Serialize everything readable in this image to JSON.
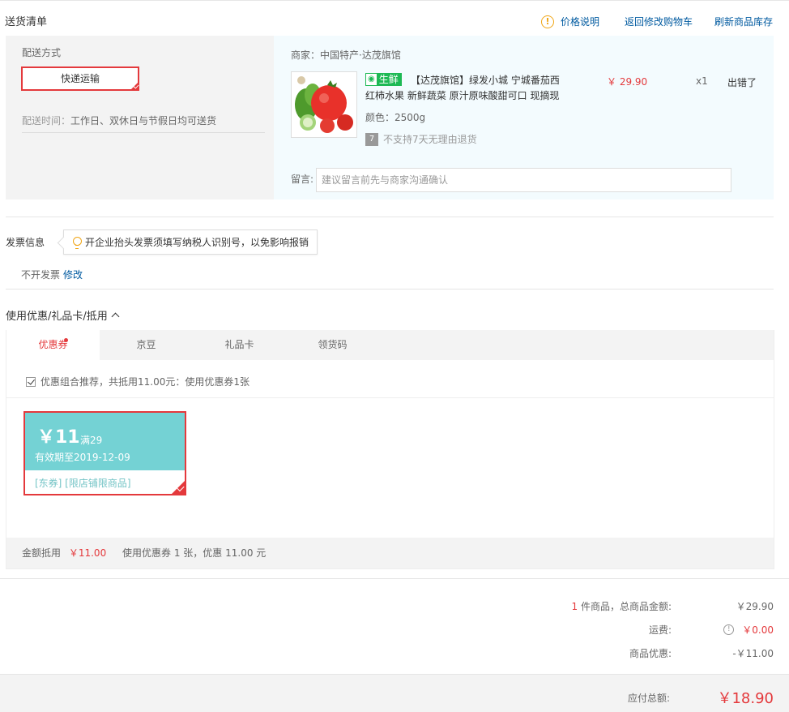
{
  "header": {
    "title": "送货清单",
    "price_info": "价格说明",
    "back_to_cart": "返回修改购物车",
    "refresh_stock": "刷新商品库存"
  },
  "delivery": {
    "method_label": "配送方式",
    "method_value": "快递运输",
    "time_label": "配送时间：",
    "time_value": "工作日、双休日与节假日均可送货"
  },
  "product": {
    "seller": "商家：中国特产·达茂旗馆",
    "badge": "生鲜",
    "name": "【达茂旗馆】绿发小城 宁城番茄西红柿水果 新鲜蔬菜 原汁原味酸甜可口 现摘现",
    "color": "颜色：2500g",
    "no_return": "不支持7天无理由退货",
    "no_return_icon": "7",
    "price": "￥ 29.90",
    "qty": "x1",
    "stock": "出错了",
    "message_label": "留言:",
    "message_placeholder": "建议留言前先与商家沟通确认"
  },
  "invoice": {
    "title": "发票信息",
    "tip": "开企业抬头发票须填写纳税人识别号，以免影响报销",
    "status": "不开发票",
    "edit": "修改"
  },
  "coupons": {
    "title": "使用优惠/礼品卡/抵用",
    "tabs": [
      "优惠券",
      "京豆",
      "礼品卡",
      "领货码"
    ],
    "combo_text": "优惠组合推荐，共抵用11.00元：使用优惠券1张",
    "coupon": {
      "amount": "￥11",
      "condition": "满29",
      "expiry": "有效期至2019-12-09",
      "tags": "[东券]  [限店铺限商品]"
    },
    "summary_label": "金额抵用",
    "summary_value": "￥11.00",
    "summary_text": "使用优惠券 1 张，优惠 11.00 元"
  },
  "totals": {
    "count": "1",
    "count_suffix": " 件商品，总商品金额:",
    "goods_amount": "￥29.90",
    "shipping_label": "运费:",
    "shipping_value": "￥0.00",
    "discount_label": "商品优惠:",
    "discount_value": "-￥11.00",
    "payable_label": "应付总额:",
    "payable_value": "￥18.90"
  },
  "colors": {
    "accent": "#e4393c",
    "link": "#005aa0",
    "coupon": "#74d2d4"
  }
}
